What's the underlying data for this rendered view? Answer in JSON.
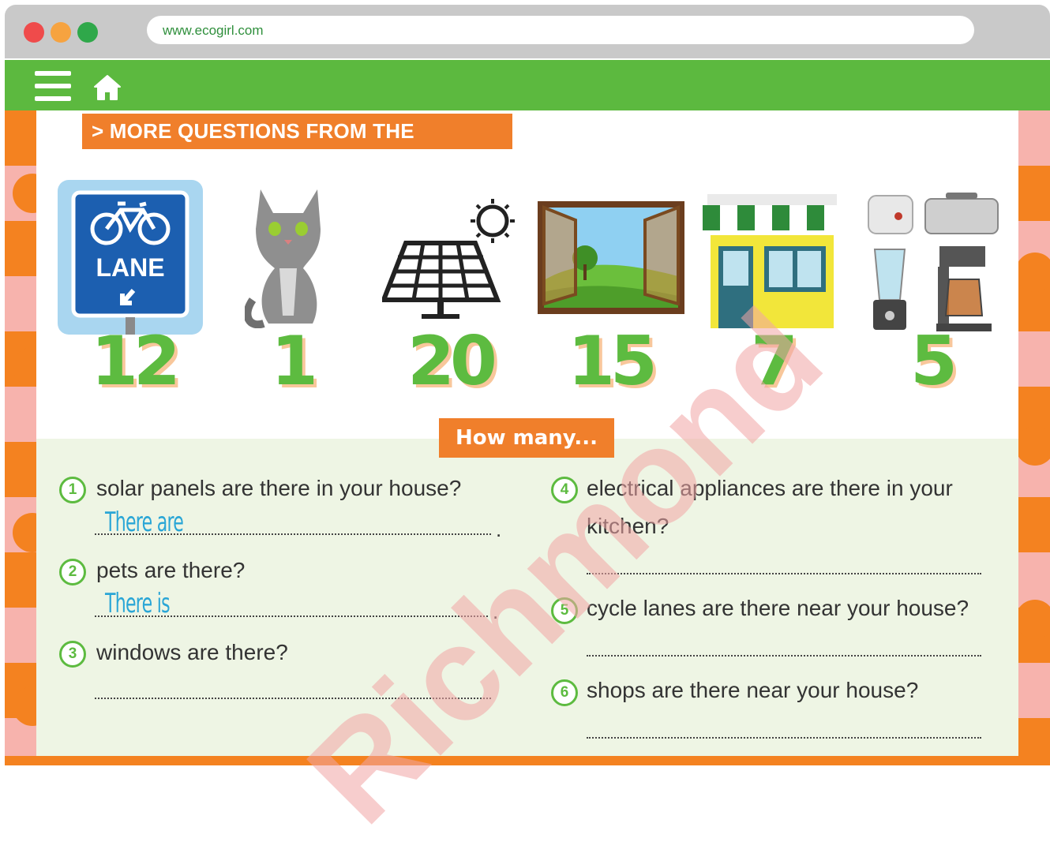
{
  "browser": {
    "url": "www.ecogirl.com",
    "window_buttons": [
      "close",
      "minimize",
      "maximize"
    ]
  },
  "nav": {
    "icons": [
      "menu-icon",
      "home-icon"
    ]
  },
  "section": {
    "title": "> MORE QUESTIONS FROM THE FOLLOWERS!"
  },
  "pictures": [
    {
      "name": "cycle-lane-sign",
      "sign_text": "LANE",
      "number": "12"
    },
    {
      "name": "cat",
      "number": "1"
    },
    {
      "name": "solar-panel",
      "number": "20"
    },
    {
      "name": "window",
      "number": "15"
    },
    {
      "name": "shop",
      "number": "7"
    },
    {
      "name": "electrical-appliances",
      "number": "5"
    }
  ],
  "exercise": {
    "title": "How many...",
    "questions": [
      {
        "num": "1",
        "text": "solar panels are there in your house?",
        "answer": "There are",
        "end": "."
      },
      {
        "num": "2",
        "text": "pets are there?",
        "answer": "There is",
        "end": "."
      },
      {
        "num": "3",
        "text": "windows are there?",
        "answer": "",
        "end": ""
      },
      {
        "num": "4",
        "text": "electrical appliances are there in your",
        "text2": "kitchen?",
        "answer": "",
        "end": ""
      },
      {
        "num": "5",
        "text": "cycle lanes are there near your house?",
        "answer": "",
        "end": ""
      },
      {
        "num": "6",
        "text": "shops are there near your house?",
        "answer": "",
        "end": ""
      }
    ]
  },
  "watermark": "Richmond",
  "colors": {
    "nav_green": "#5cb93f",
    "accent_orange": "#f07f2b",
    "number_green": "#5dbb40",
    "answer_blue": "#2aa6d6"
  }
}
